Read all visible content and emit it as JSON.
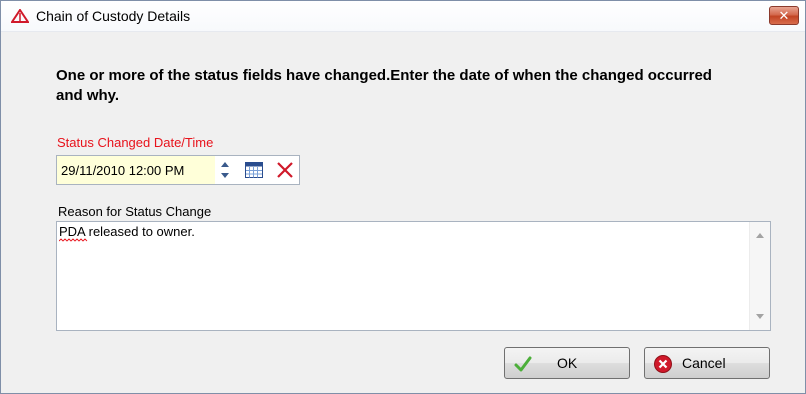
{
  "window": {
    "title": "Chain of Custody Details",
    "close_label": "✕"
  },
  "message": "One or more of the status fields have changed.Enter the date of when the changed occurred and why.",
  "status_date": {
    "label": "Status Changed Date/Time",
    "value": "29/11/2010 12:00 PM"
  },
  "reason": {
    "label": "Reason for Status Change",
    "value": "PDA released to owner."
  },
  "buttons": {
    "ok_label": "OK",
    "cancel_label": "Cancel"
  },
  "icons": {
    "title": "red-triangle-icon",
    "close": "close-icon",
    "spinner": "spinner-icon",
    "calendar": "calendar-icon",
    "clear": "red-x-icon",
    "ok": "green-check-icon",
    "cancel": "red-cancel-icon"
  },
  "colors": {
    "date_label": "#e8121b",
    "date_input_bg": "#ffffd9",
    "accent_red": "#d0192a",
    "check_green": "#4caf3a"
  }
}
